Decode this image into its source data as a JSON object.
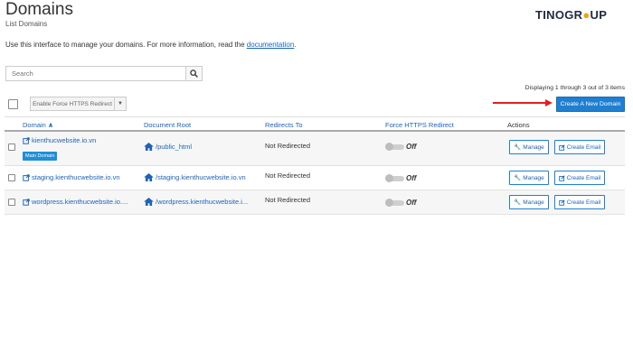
{
  "header": {
    "title": "Domains",
    "subtitle": "List Domains",
    "logo": {
      "part1": "TINO",
      "part2": "GR",
      "part3": "UP"
    }
  },
  "intro": {
    "text": "Use this interface to manage your domains. For more information, read the ",
    "link": "documentation",
    "suffix": "."
  },
  "search": {
    "placeholder": "Search",
    "value": ""
  },
  "pagination": {
    "display_text": "Displaying 1 through 3 out of 3 items"
  },
  "toolbar": {
    "bulk_action_label": "Enable Force HTTPS Redirect",
    "create_button_label": "Create A New Domain"
  },
  "table": {
    "columns": [
      "Domain",
      "Document Root",
      "Redirects To",
      "Force HTTPS Redirect",
      "Actions"
    ],
    "sort_indicator": "∧",
    "rows": [
      {
        "domain": "kienthucwebsite.io.vn",
        "badge": "Main Domain",
        "document_root": "/public_html",
        "redirects_to": "Not Redirected",
        "https": "Off",
        "manage_label": "Manage",
        "email_label": "Create Email"
      },
      {
        "domain": "staging.kienthucwebsite.io.vn",
        "badge": "",
        "document_root": "/staging.kienthucwebsite.io.vn",
        "redirects_to": "Not Redirected",
        "https": "Off",
        "manage_label": "Manage",
        "email_label": "Create Email"
      },
      {
        "domain": "wordpress.kienthucwebsite.io....",
        "badge": "",
        "document_root": "/wordpress.kienthucwebsite.i...",
        "redirects_to": "Not Redirected",
        "https": "Off",
        "manage_label": "Manage",
        "email_label": "Create Email"
      }
    ]
  },
  "colors": {
    "accent": "#1f7fd1",
    "link": "#1e63b8",
    "annotation_arrow": "#e02020",
    "logo_dark": "#1f2a44",
    "logo_accent": "#f0a500"
  }
}
